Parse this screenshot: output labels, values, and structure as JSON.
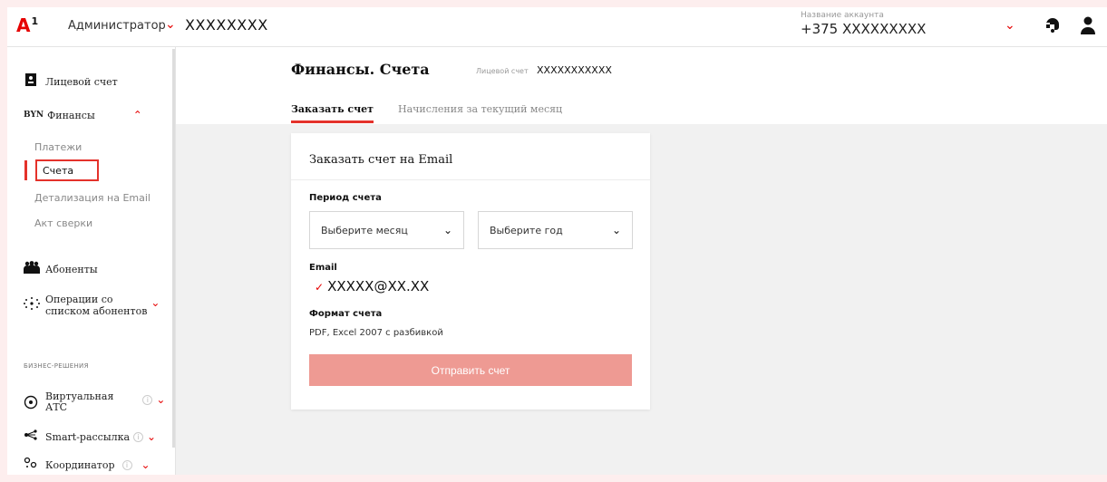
{
  "topbar": {
    "logo_letter": "A",
    "logo_sup": "1",
    "role": "Администратор",
    "account_masked": "XXXXXXXX",
    "account_name_label": "Название аккаунта",
    "phone": "+375 XXXXXXXXX",
    "icons": [
      "chevron-down-icon",
      "support-icon",
      "user-icon"
    ]
  },
  "sidebar": {
    "personal_account": "Лицевой счет",
    "finance_badge": "BYN",
    "finance": "Финансы",
    "sub_items": [
      "Платежи",
      "Счета",
      "Детализация на Email",
      "Акт сверки"
    ],
    "subscribers": "Абоненты",
    "operations_line1": "Операции со",
    "operations_line2": "списком абонентов",
    "business_section": "БИЗНЕС-РЕШЕНИЯ",
    "virtual_pbx_line1": "Виртуальная",
    "virtual_pbx_line2": "АТС",
    "smart_mailing": "Smart-рассылка",
    "coordinator": "Координатор"
  },
  "header": {
    "title": "Финансы. Счета",
    "account_label": "Лицевой счет",
    "account_value": "XXXXXXXXXXX",
    "tabs": [
      {
        "label": "Заказать счет",
        "active": true
      },
      {
        "label": "Начисления за текущий месяц",
        "active": false
      }
    ]
  },
  "card": {
    "title": "Заказать счет на Email",
    "period_label": "Период счета",
    "month_placeholder": "Выберите месяц",
    "year_placeholder": "Выберите год",
    "email_label": "Email",
    "email_value": "XXXXX@XX.XX",
    "format_label": "Формат счета",
    "format_value": "PDF, Excel 2007 с разбивкой",
    "submit": "Отправить счет"
  },
  "colors": {
    "accent": "#e60000",
    "highlight_box": "#e4322b",
    "button_disabled": "#ee9a93",
    "background": "#f1f1f1"
  }
}
